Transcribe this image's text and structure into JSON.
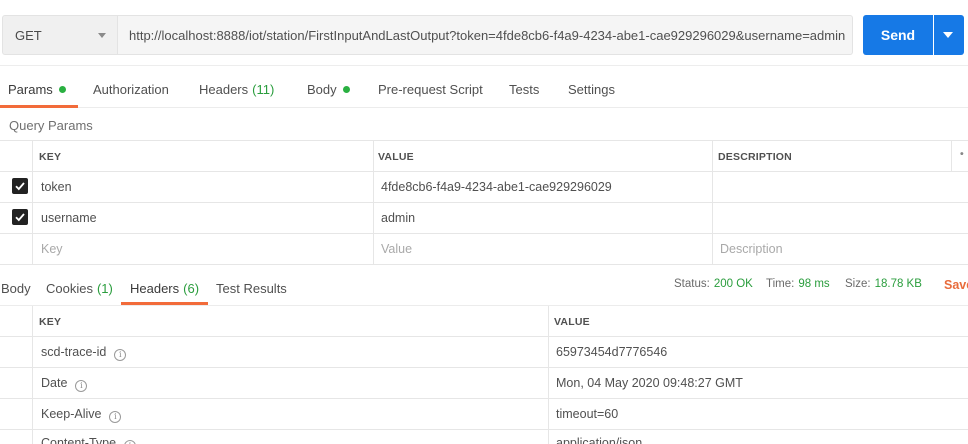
{
  "request": {
    "method": "GET",
    "url": "http://localhost:8888/iot/station/FirstInputAndLastOutput?token=4fde8cb6-f4a9-4234-abe1-cae929296029&username=admin",
    "send_label": "Send"
  },
  "request_tabs": [
    {
      "label": "Params",
      "active": true,
      "dot": true
    },
    {
      "label": "Authorization"
    },
    {
      "label": "Headers",
      "count": "(11)"
    },
    {
      "label": "Body",
      "dot": true
    },
    {
      "label": "Pre-request Script"
    },
    {
      "label": "Tests"
    },
    {
      "label": "Settings"
    }
  ],
  "query_params": {
    "title": "Query Params",
    "headers": {
      "key": "KEY",
      "value": "VALUE",
      "description": "DESCRIPTION"
    },
    "rows": [
      {
        "checked": true,
        "key": "token",
        "value": "4fde8cb6-f4a9-4234-abe1-cae929296029",
        "description": ""
      },
      {
        "checked": true,
        "key": "username",
        "value": "admin",
        "description": ""
      }
    ],
    "placeholder": {
      "key": "Key",
      "value": "Value",
      "description": "Description"
    }
  },
  "response_tabs": [
    {
      "label": "Body"
    },
    {
      "label": "Cookies",
      "count": "(1)"
    },
    {
      "label": "Headers",
      "count": "(6)",
      "active": true
    },
    {
      "label": "Test Results"
    }
  ],
  "response_status": {
    "status_label": "Status:",
    "status_value": "200 OK",
    "time_label": "Time:",
    "time_value": "98 ms",
    "size_label": "Size:",
    "size_value": "18.78 KB",
    "save_label": "Save"
  },
  "response_headers": {
    "headers": {
      "key": "KEY",
      "value": "VALUE"
    },
    "rows": [
      {
        "key": "scd-trace-id",
        "value": "65973454d7776546"
      },
      {
        "key": "Date",
        "value": "Mon, 04 May 2020 09:48:27 GMT"
      },
      {
        "key": "Keep-Alive",
        "value": "timeout=60"
      },
      {
        "key": "Content-Type",
        "value": "application/json"
      }
    ]
  },
  "colors": {
    "accent": "#f26b3a",
    "send": "#1679e6",
    "success": "#2a9d3d"
  }
}
